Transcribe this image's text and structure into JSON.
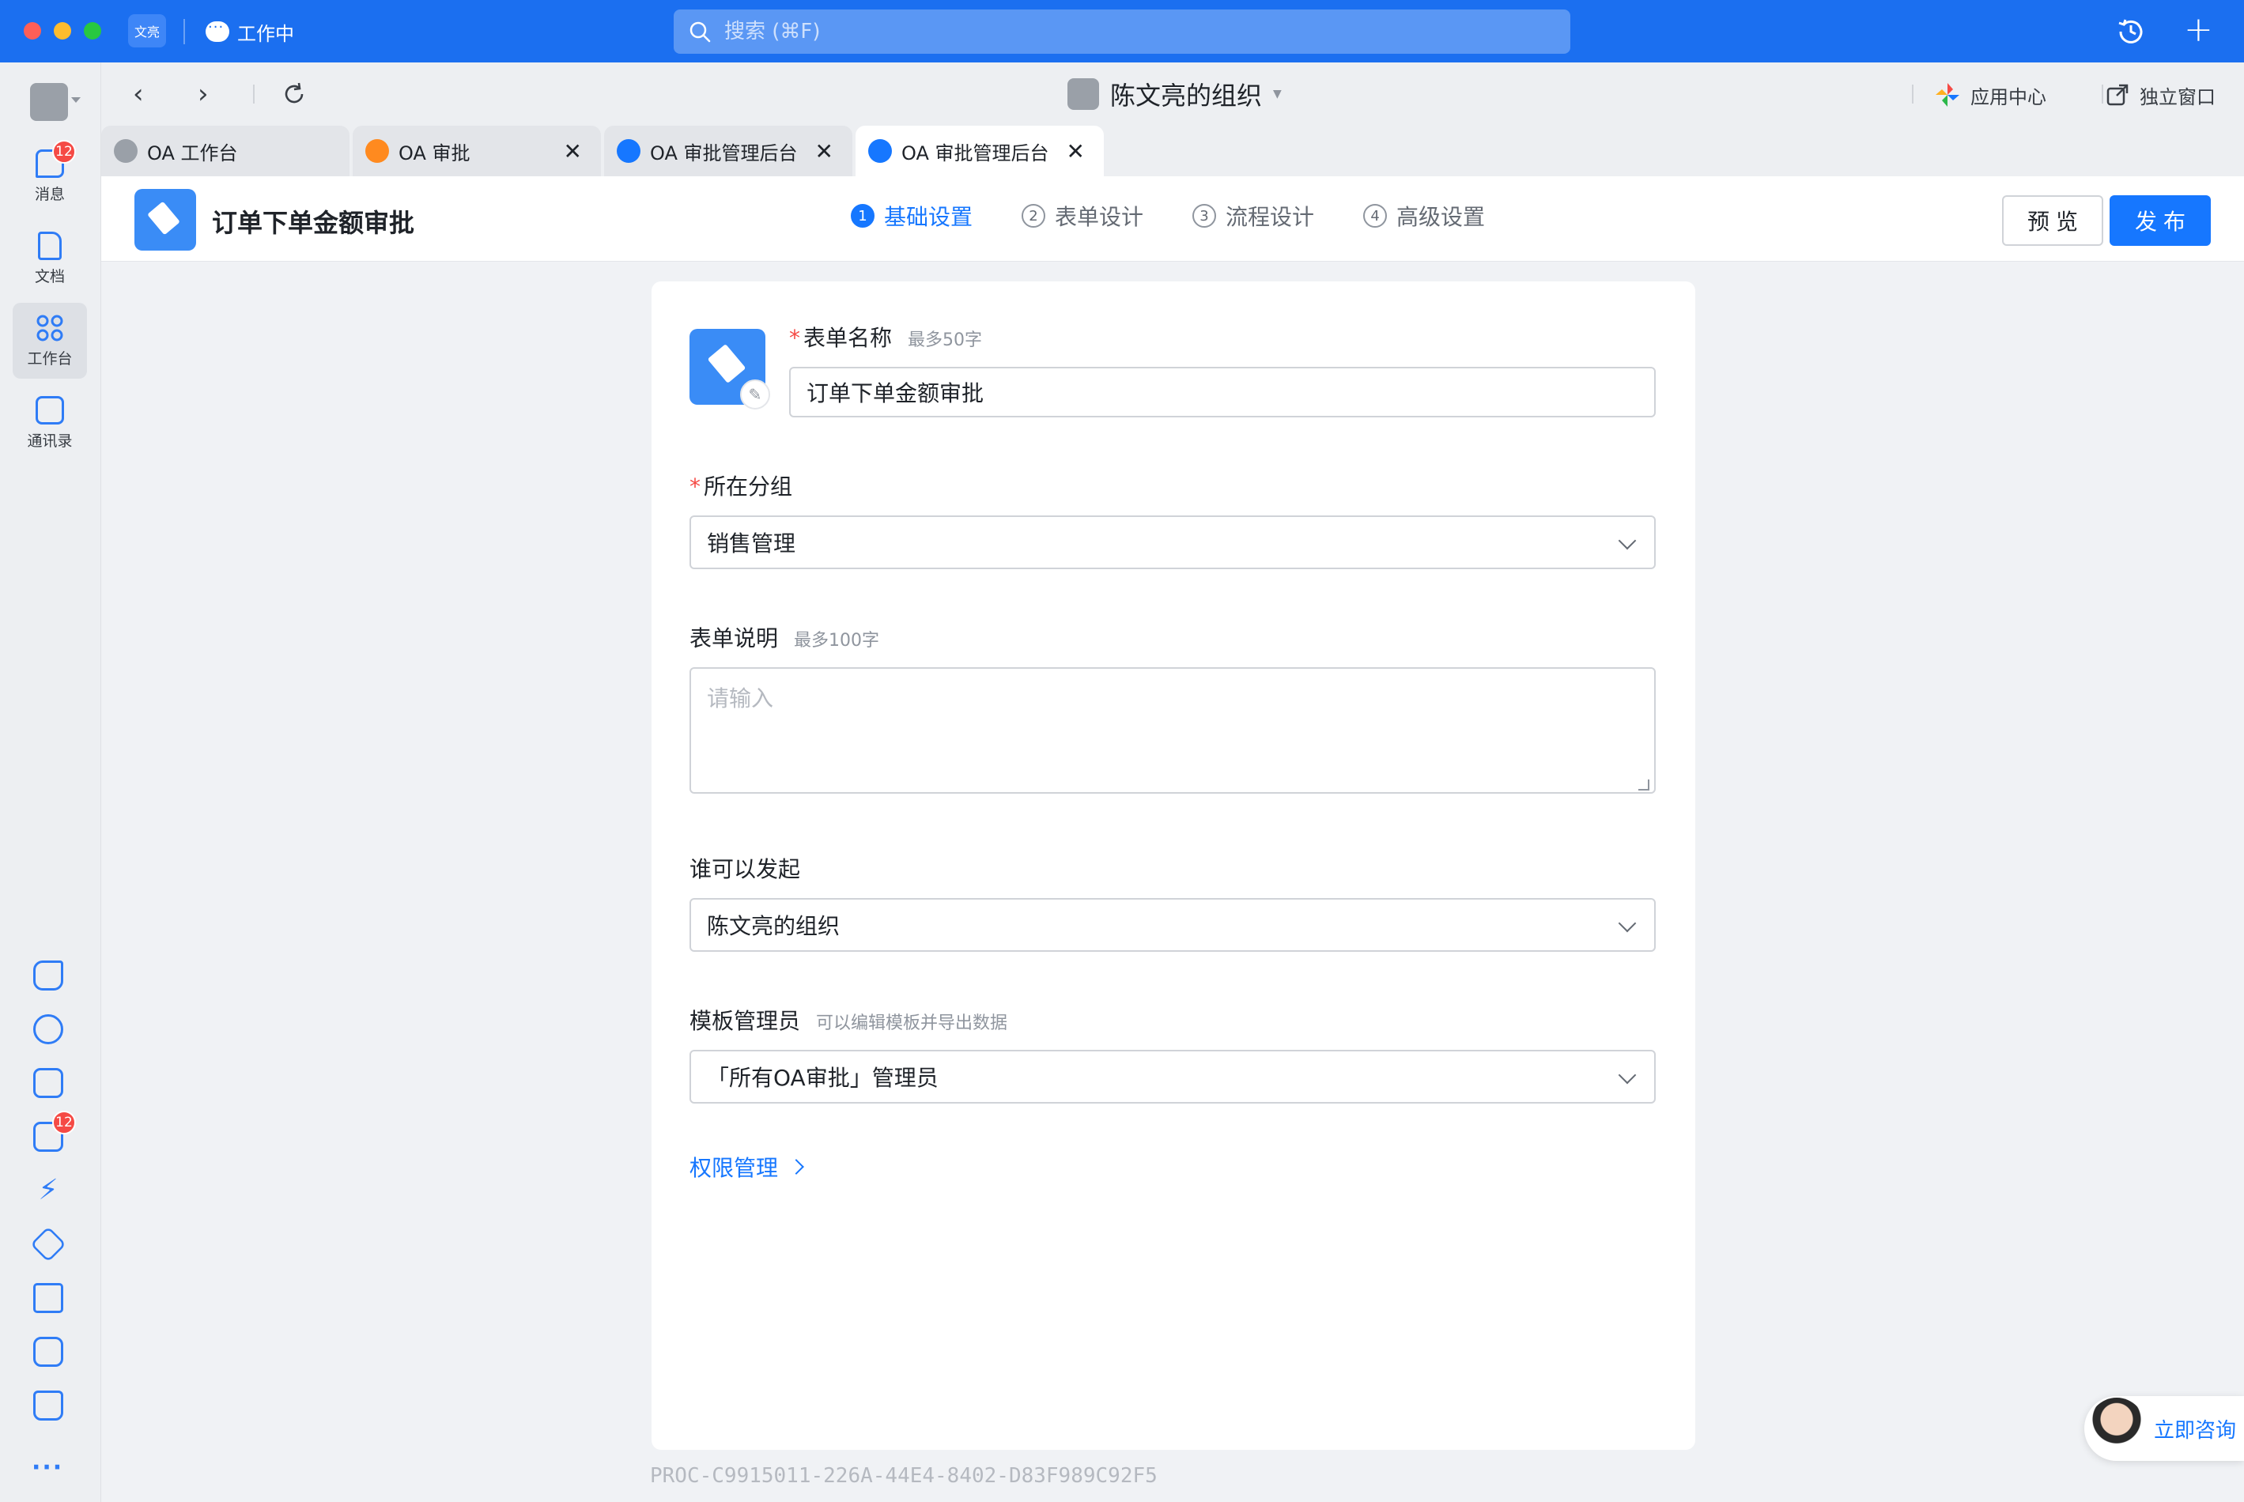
{
  "titlebar": {
    "brand": "文亮",
    "status": "工作中",
    "search_placeholder": "搜索 (⌘F)"
  },
  "rail": {
    "items": [
      {
        "label": "消息",
        "badge": "12"
      },
      {
        "label": "文档"
      },
      {
        "label": "工作台",
        "active": true
      },
      {
        "label": "通讯录"
      }
    ],
    "bottom_badge": "12",
    "more": "···"
  },
  "navrow": {
    "org_title": "陈文亮的组织",
    "app_center": "应用中心",
    "standalone": "独立窗口"
  },
  "tabs": [
    {
      "label": "OA 工作台",
      "icon_color": "#9aa0a8"
    },
    {
      "label": "OA 审批",
      "icon_color": "#ff8a1f"
    },
    {
      "label": "OA 审批管理后台",
      "icon_color": "#1677ff"
    },
    {
      "label": "OA 审批管理后台",
      "icon_color": "#1677ff",
      "active": true
    }
  ],
  "appbar": {
    "title": "订单下单金额审批",
    "steps": [
      {
        "num": "1",
        "label": "基础设置",
        "active": true
      },
      {
        "num": "2",
        "label": "表单设计"
      },
      {
        "num": "3",
        "label": "流程设计"
      },
      {
        "num": "4",
        "label": "高级设置"
      }
    ],
    "preview": "预览",
    "publish": "发布"
  },
  "form": {
    "name": {
      "required": "*",
      "label": "表单名称",
      "hint": "最多50字",
      "value": "订单下单金额审批"
    },
    "group": {
      "required": "*",
      "label": "所在分组",
      "value": "销售管理"
    },
    "desc": {
      "label": "表单说明",
      "hint": "最多100字",
      "placeholder": "请输入"
    },
    "initiator": {
      "label": "谁可以发起",
      "value": "陈文亮的组织"
    },
    "admin": {
      "label": "模板管理员",
      "hint": "可以编辑模板并导出数据",
      "value": "「所有OA审批」管理员"
    },
    "permission_link": "权限管理"
  },
  "proc_id": "PROC-C9915011-226A-44E4-8402-D83F989C92F5",
  "consult": "立即咨询",
  "colors": {
    "accent": "#1677ff",
    "titlebar": "#1b6ff0",
    "danger": "#f54a45"
  }
}
